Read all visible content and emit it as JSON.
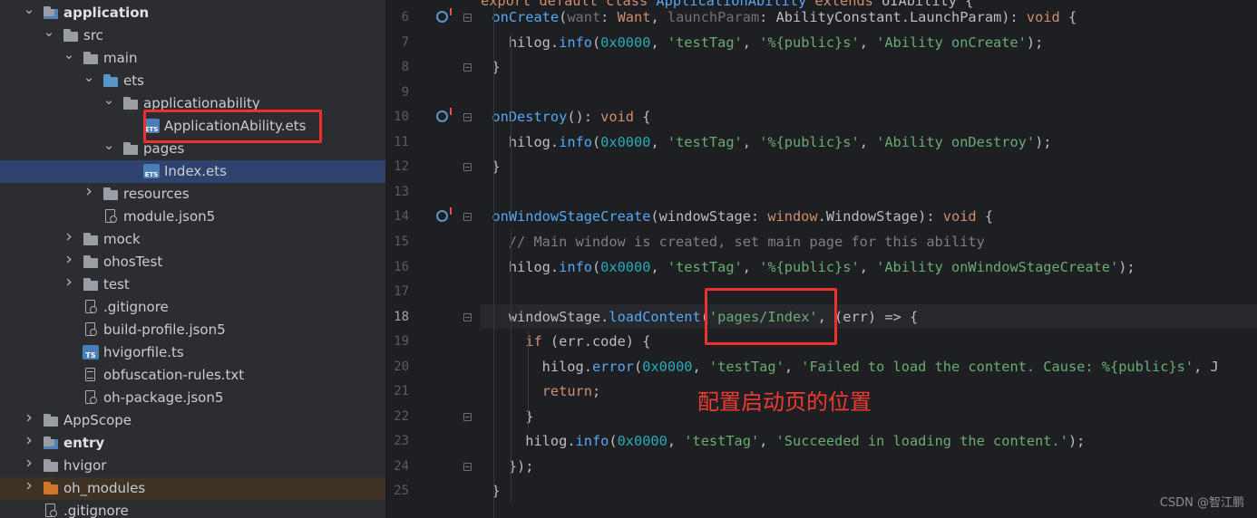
{
  "project_tree": [
    {
      "label": "application",
      "depth": 0,
      "state": "expanded",
      "icon": "module-folder",
      "bold": true
    },
    {
      "label": "src",
      "depth": 1,
      "state": "expanded",
      "icon": "folder-gray"
    },
    {
      "label": "main",
      "depth": 2,
      "state": "expanded",
      "icon": "folder-gray"
    },
    {
      "label": "ets",
      "depth": 3,
      "state": "expanded",
      "icon": "folder-blue"
    },
    {
      "label": "applicationability",
      "depth": 4,
      "state": "expanded",
      "icon": "folder-gray"
    },
    {
      "label": "ApplicationAbility.ets",
      "depth": 5,
      "state": "leaf",
      "icon": "ets-file"
    },
    {
      "label": "pages",
      "depth": 4,
      "state": "expanded",
      "icon": "folder-gray"
    },
    {
      "label": "Index.ets",
      "depth": 5,
      "state": "leaf",
      "icon": "ets-file",
      "selected": true
    },
    {
      "label": "resources",
      "depth": 3,
      "state": "collapsed",
      "icon": "folder-gray"
    },
    {
      "label": "module.json5",
      "depth": 3,
      "state": "leaf",
      "icon": "json-file"
    },
    {
      "label": "mock",
      "depth": 2,
      "state": "collapsed",
      "icon": "folder-gray"
    },
    {
      "label": "ohosTest",
      "depth": 2,
      "state": "collapsed",
      "icon": "folder-gray"
    },
    {
      "label": "test",
      "depth": 2,
      "state": "collapsed",
      "icon": "folder-gray"
    },
    {
      "label": ".gitignore",
      "depth": 2,
      "state": "leaf",
      "icon": "git-file"
    },
    {
      "label": "build-profile.json5",
      "depth": 2,
      "state": "leaf",
      "icon": "json-file"
    },
    {
      "label": "hvigorfile.ts",
      "depth": 2,
      "state": "leaf",
      "icon": "ts-file"
    },
    {
      "label": "obfuscation-rules.txt",
      "depth": 2,
      "state": "leaf",
      "icon": "text-file"
    },
    {
      "label": "oh-package.json5",
      "depth": 2,
      "state": "leaf",
      "icon": "json-file"
    },
    {
      "label": "AppScope",
      "depth": 0,
      "state": "collapsed",
      "icon": "folder-gray"
    },
    {
      "label": "entry",
      "depth": 0,
      "state": "collapsed",
      "icon": "module-folder",
      "bold": true
    },
    {
      "label": "hvigor",
      "depth": 0,
      "state": "collapsed",
      "icon": "folder-gray"
    },
    {
      "label": "oh_modules",
      "depth": 0,
      "state": "collapsed",
      "icon": "folder-orange",
      "highlight": true
    },
    {
      "label": ".gitignore",
      "depth": 0,
      "state": "leaf",
      "icon": "git-file"
    }
  ],
  "editor": {
    "top_partial": "export default class ApplicationAbility extends UIAbility {",
    "lines": [
      {
        "n": "6",
        "marker": "implement-icon",
        "fold": true,
        "tokens": [
          [
            "  ",
            ""
          ],
          [
            "onCreate",
            "fn"
          ],
          [
            "(",
            "ty"
          ],
          [
            "want",
            "pm"
          ],
          [
            ": ",
            "ty"
          ],
          [
            "Want",
            "kw"
          ],
          [
            ", ",
            "ty"
          ],
          [
            "launchParam",
            "pm"
          ],
          [
            ": ",
            "ty"
          ],
          [
            "AbilityConstant",
            "ty"
          ],
          [
            ".",
            "ty"
          ],
          [
            "LaunchParam",
            "ty"
          ],
          [
            "): ",
            "ty"
          ],
          [
            "void",
            "kw"
          ],
          [
            " {",
            "ty"
          ]
        ]
      },
      {
        "n": "7",
        "tokens": [
          [
            "    hilog",
            "ty"
          ],
          [
            ".",
            "ty"
          ],
          [
            "info",
            "fn"
          ],
          [
            "(",
            "ty"
          ],
          [
            "0x0000",
            "num"
          ],
          [
            ", ",
            "ty"
          ],
          [
            "'testTag'",
            "str"
          ],
          [
            ", ",
            "ty"
          ],
          [
            "'%{public}s'",
            "str"
          ],
          [
            ", ",
            "ty"
          ],
          [
            "'Ability onCreate'",
            "str"
          ],
          [
            ");",
            "ty"
          ]
        ]
      },
      {
        "n": "8",
        "fold": true,
        "tokens": [
          [
            "  }",
            "ty"
          ]
        ]
      },
      {
        "n": "9",
        "tokens": []
      },
      {
        "n": "10",
        "marker": "implement-icon",
        "fold": true,
        "tokens": [
          [
            "  ",
            ""
          ],
          [
            "onDestroy",
            "fn"
          ],
          [
            "(): ",
            "ty"
          ],
          [
            "void",
            "kw"
          ],
          [
            " {",
            "ty"
          ]
        ]
      },
      {
        "n": "11",
        "tokens": [
          [
            "    hilog",
            "ty"
          ],
          [
            ".",
            "ty"
          ],
          [
            "info",
            "fn"
          ],
          [
            "(",
            "ty"
          ],
          [
            "0x0000",
            "num"
          ],
          [
            ", ",
            "ty"
          ],
          [
            "'testTag'",
            "str"
          ],
          [
            ", ",
            "ty"
          ],
          [
            "'%{public}s'",
            "str"
          ],
          [
            ", ",
            "ty"
          ],
          [
            "'Ability onDestroy'",
            "str"
          ],
          [
            ");",
            "ty"
          ]
        ]
      },
      {
        "n": "12",
        "fold": true,
        "tokens": [
          [
            "  }",
            "ty"
          ]
        ]
      },
      {
        "n": "13",
        "tokens": []
      },
      {
        "n": "14",
        "marker": "implement-icon",
        "fold": true,
        "tokens": [
          [
            "  ",
            ""
          ],
          [
            "onWindowStageCreate",
            "fn"
          ],
          [
            "(windowStage: ",
            "ty"
          ],
          [
            "window",
            "kw"
          ],
          [
            ".",
            "ty"
          ],
          [
            "WindowStage",
            "ty"
          ],
          [
            "): ",
            "ty"
          ],
          [
            "void",
            "kw"
          ],
          [
            " {",
            "ty"
          ]
        ]
      },
      {
        "n": "15",
        "tokens": [
          [
            "    // Main window is created, set main page for this ability",
            "cmt"
          ]
        ]
      },
      {
        "n": "16",
        "tokens": [
          [
            "    hilog",
            "ty"
          ],
          [
            ".",
            "ty"
          ],
          [
            "info",
            "fn"
          ],
          [
            "(",
            "ty"
          ],
          [
            "0x0000",
            "num"
          ],
          [
            ", ",
            "ty"
          ],
          [
            "'testTag'",
            "str"
          ],
          [
            ", ",
            "ty"
          ],
          [
            "'%{public}s'",
            "str"
          ],
          [
            ", ",
            "ty"
          ],
          [
            "'Ability onWindowStageCreate'",
            "str"
          ],
          [
            ");",
            "ty"
          ]
        ]
      },
      {
        "n": "17",
        "marker": "bulb-icon",
        "tokens": []
      },
      {
        "n": "18",
        "current": true,
        "fold": true,
        "tokens": [
          [
            "    windowStage",
            "ty"
          ],
          [
            ".",
            "ty"
          ],
          [
            "loadContent",
            "fn"
          ],
          [
            "(",
            "ty"
          ],
          [
            "'pages/Index'",
            "str"
          ],
          [
            ", (err) => {",
            "ty"
          ]
        ]
      },
      {
        "n": "19",
        "tokens": [
          [
            "      ",
            ""
          ],
          [
            "if",
            "kw"
          ],
          [
            " (err.code) {",
            "ty"
          ]
        ]
      },
      {
        "n": "20",
        "tokens": [
          [
            "        hilog",
            "ty"
          ],
          [
            ".",
            "ty"
          ],
          [
            "error",
            "fn"
          ],
          [
            "(",
            "ty"
          ],
          [
            "0x0000",
            "num"
          ],
          [
            ", ",
            "ty"
          ],
          [
            "'testTag'",
            "str"
          ],
          [
            ", ",
            "ty"
          ],
          [
            "'Failed to load the content. Cause: %{public}s'",
            "str"
          ],
          [
            ", J",
            "ty"
          ]
        ]
      },
      {
        "n": "21",
        "tokens": [
          [
            "        ",
            ""
          ],
          [
            "return",
            "kw"
          ],
          [
            ";",
            "ty"
          ]
        ]
      },
      {
        "n": "22",
        "fold": true,
        "tokens": [
          [
            "      }",
            "ty"
          ]
        ]
      },
      {
        "n": "23",
        "tokens": [
          [
            "      hilog",
            "ty"
          ],
          [
            ".",
            "ty"
          ],
          [
            "info",
            "fn"
          ],
          [
            "(",
            "ty"
          ],
          [
            "0x0000",
            "num"
          ],
          [
            ", ",
            "ty"
          ],
          [
            "'testTag'",
            "str"
          ],
          [
            ", ",
            "ty"
          ],
          [
            "'Succeeded in loading the content.'",
            "str"
          ],
          [
            ");",
            "ty"
          ]
        ]
      },
      {
        "n": "24",
        "fold": true,
        "tokens": [
          [
            "    });",
            "ty"
          ]
        ]
      },
      {
        "n": "25",
        "tokens": [
          [
            "  }",
            "ty"
          ]
        ]
      }
    ]
  },
  "annotation_text": "配置启动页的位置",
  "watermark": "CSDN @智江鹏",
  "colors": {
    "annotation_red": "#f0302c",
    "selection_bg": "#2e436e",
    "keyword": "#cf8e6d",
    "function": "#56a8f5",
    "string": "#6aab73",
    "number": "#2aacb8",
    "comment": "#7a7e85"
  }
}
